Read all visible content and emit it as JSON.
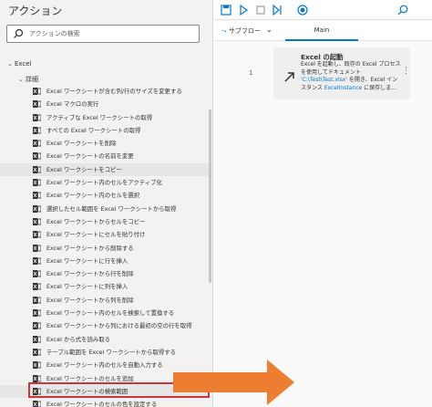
{
  "left_pane": {
    "title": "アクション",
    "search_placeholder": "アクションの検索",
    "group_label": "Excel",
    "subgroup_label": "詳細",
    "items": [
      "Excel ワークシートが含む列/行のサイズを変更する",
      "Excel マクロの実行",
      "アクティブな Excel ワークシートの取得",
      "すべての Excel ワークシートの取得",
      "Excel ワークシートを削除",
      "Excel ワークシートの名前を変更",
      "Excel ワークシートをコピー",
      "Excel ワークシート内のセルをアクティブ化",
      "Excel ワークシート内のセルを選択",
      "選択したセル範囲を Excel ワークシートから取得",
      "Excel ワークシートからセルをコピー",
      "Excel ワークシートにセルを貼り付け",
      "Excel ワークシートから削除する",
      "Excel ワークシートに行を挿入",
      "Excel ワークシートから行を削除",
      "Excel ワークシートに列を挿入",
      "Excel ワークシートから列を削除",
      "Excel ワークシート内のセルを検索して置換する",
      "Excel ワークシートから列における最初の空の行を取得",
      "Excel から式を読み取る",
      "テーブル範囲を Excel ワークシートから取得する",
      "Excel ワークシート内のセルを自動入力する",
      "Excel ワークシートのセルを追加",
      "Excel ワークシートの検索範囲",
      "Excel ワークシートのセルの色を設定する"
    ],
    "hovered_index": 6,
    "highlighted_index": 23
  },
  "toolbar": {
    "icons": [
      "save-icon",
      "run-icon",
      "stop-icon",
      "step-icon",
      "record-icon",
      "search-icon"
    ]
  },
  "tabs": {
    "subflow_label": "サブフロー",
    "main_label": "Main"
  },
  "step": {
    "number": "1",
    "title": "Excel の起動",
    "desc_part1": "Excel を起動し、既存の Excel ブロセスを使用してドキュメント ",
    "desc_link1": "'C:\\Test\\Test.xlsx'",
    "desc_part2": " を開き、Excel インスタンス ",
    "desc_link2": "ExcelInstance",
    "desc_part3": " に保存しま..."
  },
  "colors": {
    "accent": "#0078d4",
    "highlight_border": "#d13438",
    "arrow": "#ed7d31",
    "excel_icon": "#323130"
  }
}
